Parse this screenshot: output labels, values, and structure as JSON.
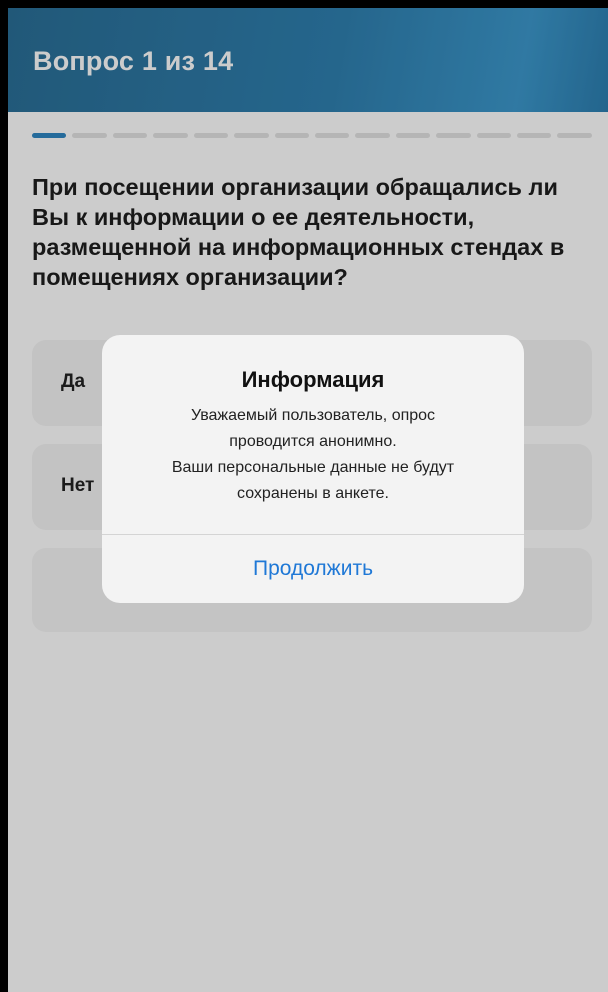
{
  "header": {
    "title": "Вопрос 1 из 14"
  },
  "progress": {
    "current": 1,
    "total": 14
  },
  "question": {
    "text": "При посещении организации обращались ли Вы к информации о ее деятельности, размещенной на информационных стендах в помещениях организации?"
  },
  "options": [
    {
      "label": "Да"
    },
    {
      "label": "Нет"
    },
    {
      "label": ""
    }
  ],
  "dialog": {
    "title": "Информация",
    "message_lines": [
      "Уважаемый пользователь, опрос",
      "проводится анонимно.",
      "Ваши персональные данные не будут",
      "сохранены в анкете."
    ],
    "button_label": "Продолжить"
  },
  "colors": {
    "header": "#2f80b0",
    "progress_active": "#2f86c2",
    "dialog_button": "#1f78d6"
  }
}
